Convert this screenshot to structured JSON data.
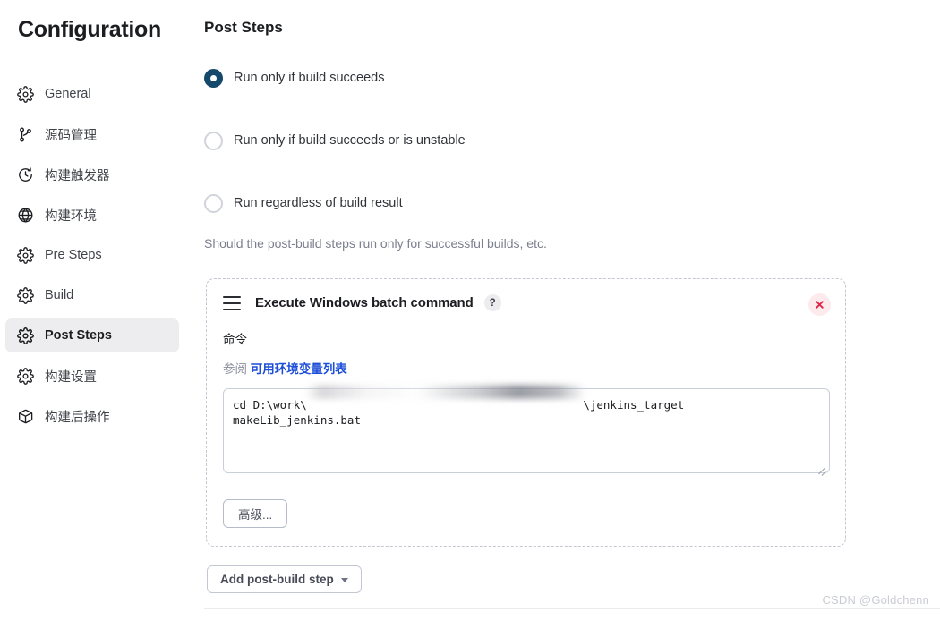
{
  "sidebar": {
    "title": "Configuration",
    "items": [
      {
        "label": "General",
        "icon": "gear-icon",
        "active": false
      },
      {
        "label": "源码管理",
        "icon": "branch-icon",
        "active": false
      },
      {
        "label": "构建触发器",
        "icon": "clock-icon",
        "active": false
      },
      {
        "label": "构建环境",
        "icon": "globe-icon",
        "active": false
      },
      {
        "label": "Pre Steps",
        "icon": "gear-icon",
        "active": false
      },
      {
        "label": "Build",
        "icon": "gear-icon",
        "active": false
      },
      {
        "label": "Post Steps",
        "icon": "gear-icon",
        "active": true
      },
      {
        "label": "构建设置",
        "icon": "gear-icon",
        "active": false
      },
      {
        "label": "构建后操作",
        "icon": "package-icon",
        "active": false
      }
    ]
  },
  "main": {
    "section_title": "Post Steps",
    "radios": [
      {
        "label": "Run only if build succeeds",
        "checked": true
      },
      {
        "label": "Run only if build succeeds or is unstable",
        "checked": false
      },
      {
        "label": "Run regardless of build result",
        "checked": false
      }
    ],
    "help_text": "Should the post-build steps run only for successful builds, etc.",
    "step": {
      "name": "Execute Windows batch command",
      "help_badge": "?",
      "drag_handle_icon": "drag-handle-icon",
      "close_icon": "close-icon",
      "field_label": "命令",
      "hint_prefix": "参阅",
      "hint_link": "可用环境变量列表",
      "command_value": "cd D:\\work\\                                         \\jenkins_target\nmakeLib_jenkins.bat",
      "advanced_label": "高级..."
    },
    "add_step_label": "Add post-build step"
  },
  "watermark": "CSDN @Goldchenn",
  "colors": {
    "radio_selected": "#14496b",
    "link": "#1d4ed8",
    "close_bg": "#fdeaec",
    "close_x": "#e0274a",
    "sidebar_active_bg": "#ededef"
  }
}
